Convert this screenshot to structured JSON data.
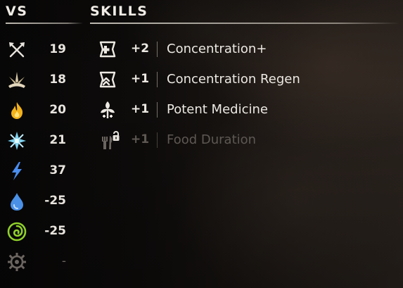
{
  "headers": {
    "vs": "VS",
    "skills": "SKILLS"
  },
  "vs": [
    {
      "icon": "melee-crossed-arrows-icon",
      "value": "19",
      "color": "#e6e2dc"
    },
    {
      "icon": "impact-burst-icon",
      "value": "18",
      "color": "#d8c9a8"
    },
    {
      "icon": "fire-icon",
      "value": "20",
      "color": "#f2b21c"
    },
    {
      "icon": "frost-icon",
      "value": "21",
      "color": "#7fd3f0"
    },
    {
      "icon": "shock-icon",
      "value": "37",
      "color": "#4a8df0"
    },
    {
      "icon": "water-drop-icon",
      "value": "-25",
      "color": "#4a90e6"
    },
    {
      "icon": "acid-spiral-icon",
      "value": "-25",
      "color": "#8fd12a"
    },
    {
      "icon": "plasma-gear-icon",
      "value": "-",
      "color": "#6b6560"
    }
  ],
  "skills": [
    {
      "icon": "concentration-plus-icon",
      "bonus": "+2",
      "name": "Concentration+",
      "locked": false
    },
    {
      "icon": "concentration-regen-icon",
      "bonus": "+1",
      "name": "Concentration Regen",
      "locked": false
    },
    {
      "icon": "potent-medicine-icon",
      "bonus": "+1",
      "name": "Potent Medicine",
      "locked": false
    },
    {
      "icon": "food-duration-locked-icon",
      "bonus": "+1",
      "name": "Food Duration",
      "locked": true
    }
  ]
}
